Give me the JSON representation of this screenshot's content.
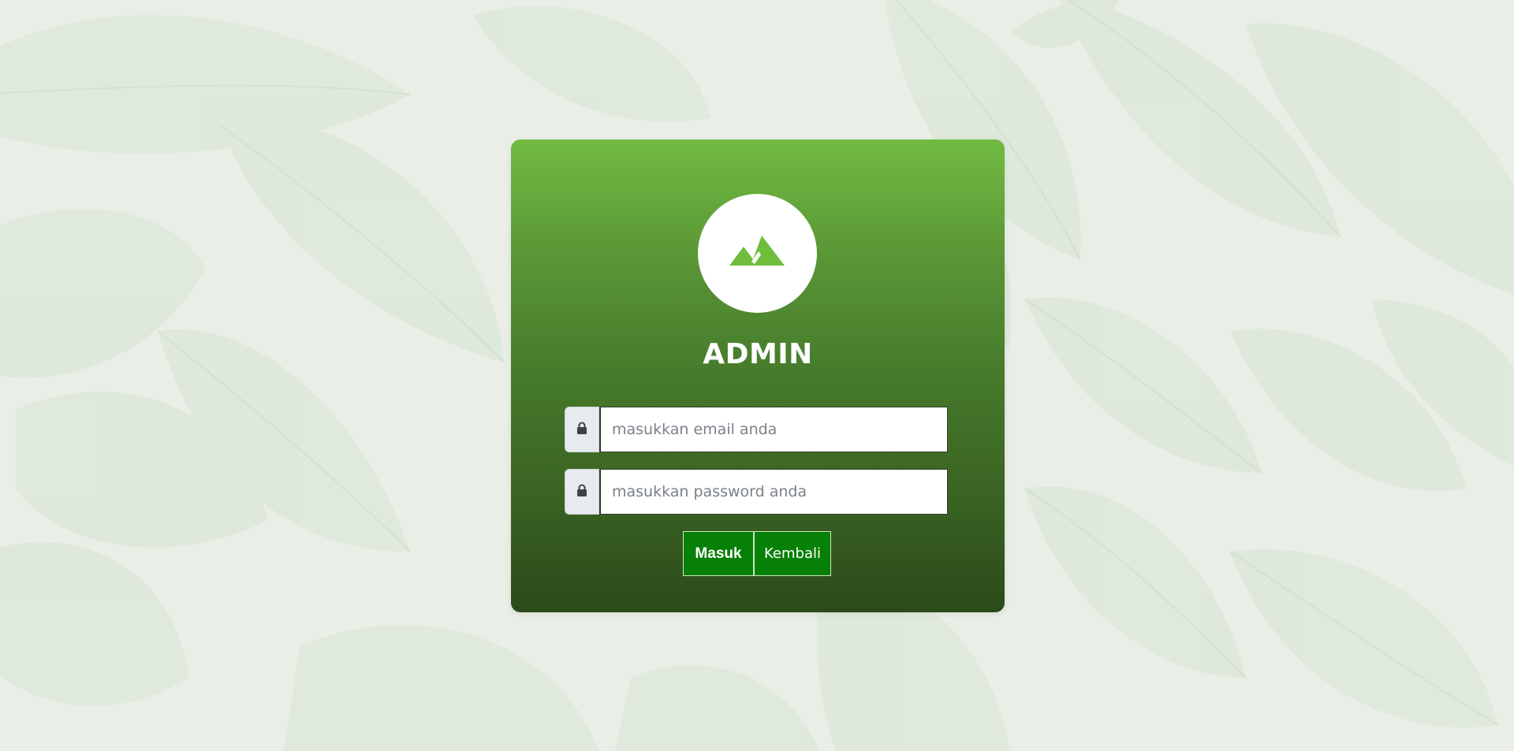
{
  "page": {
    "background_color": "#e9eee6",
    "card_gradient_top": "#71bb42",
    "card_gradient_bottom": "#2b4a1a"
  },
  "login": {
    "logo_icon": "mountain-icon",
    "title": "ADMIN",
    "email": {
      "icon": "lock-icon",
      "value": "",
      "placeholder": "masukkan email anda"
    },
    "password": {
      "icon": "lock-icon",
      "value": "",
      "placeholder": "masukkan password anda"
    },
    "buttons": {
      "submit_label": "Masuk",
      "back_label": "Kembali",
      "color": "#068006"
    }
  }
}
